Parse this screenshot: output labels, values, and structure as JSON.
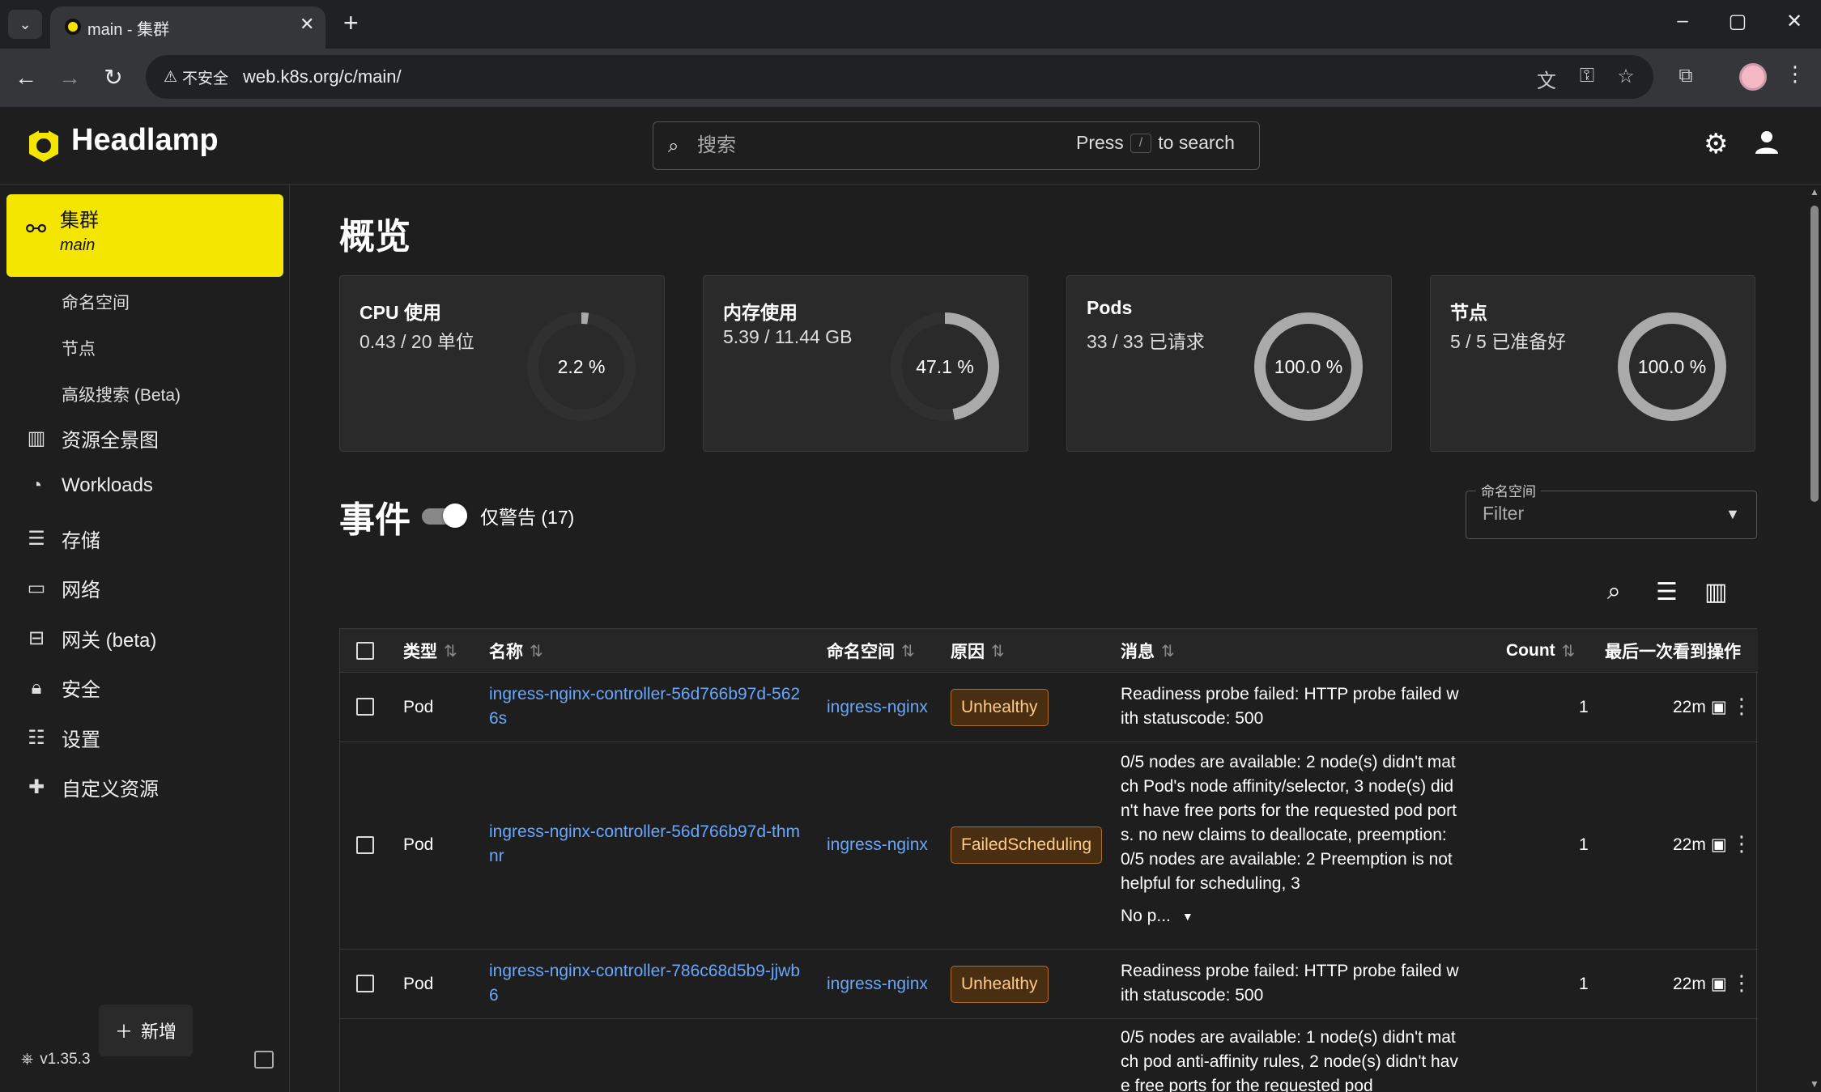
{
  "browser": {
    "tab_title": "main - 集群",
    "insecure_label": "不安全",
    "url": "web.k8s.org/c/main/"
  },
  "header": {
    "app_name": "Headlamp",
    "search_placeholder": "搜索",
    "search_hint_press": "Press",
    "search_hint_key": "/",
    "search_hint_suffix": "to search"
  },
  "sidebar": {
    "cluster_label": "集群",
    "cluster_name": "main",
    "subitems": [
      "命名空间",
      "节点",
      "高级搜索 (Beta)"
    ],
    "items": [
      "资源全景图",
      "Workloads",
      "存储",
      "网络",
      "网关 (beta)",
      "安全",
      "设置",
      "自定义资源"
    ],
    "add_label": "新增",
    "version": "v1.35.3"
  },
  "overview": {
    "title": "概览",
    "cards": [
      {
        "title": "CPU 使用",
        "value": "0.43 / 20 单位",
        "percent_label": "2.2 %",
        "percent": 2.2
      },
      {
        "title": "内存使用",
        "value": "5.39 / 11.44 GB",
        "percent_label": "47.1 %",
        "percent": 47.1
      },
      {
        "title": "Pods",
        "value": "33 / 33 已请求",
        "percent_label": "100.0 %",
        "percent": 100
      },
      {
        "title": "节点",
        "value": "5 / 5 已准备好",
        "percent_label": "100.0 %",
        "percent": 100
      }
    ]
  },
  "events": {
    "title": "事件",
    "warnings_only_label": "仅警告 (17)",
    "warnings_only_on": true,
    "namespace_filter_label": "命名空间",
    "namespace_filter_placeholder": "Filter",
    "columns": [
      "类型",
      "名称",
      "命名空间",
      "原因",
      "消息",
      "Count",
      "最后一次看到",
      "操作"
    ],
    "rows": [
      {
        "type": "Pod",
        "name": "ingress-nginx-controller-56d766b97d-5626s",
        "namespace": "ingress-nginx",
        "reason": "Unhealthy",
        "message": "Readiness probe failed: HTTP probe failed with statuscode: 500",
        "count": "1",
        "last_seen": "22m"
      },
      {
        "type": "Pod",
        "name": "ingress-nginx-controller-56d766b97d-thmnr",
        "namespace": "ingress-nginx",
        "reason": "FailedScheduling",
        "message": "0/5 nodes are available: 2 node(s) didn't match Pod's node affinity/selector, 3 node(s) didn't have free ports for the requested pod ports. no new claims to deallocate, preemption: 0/5 nodes are available: 2 Preemption is not helpful for scheduling, 3",
        "message_more": "No p...",
        "count": "1",
        "last_seen": "22m"
      },
      {
        "type": "Pod",
        "name": "ingress-nginx-controller-786c68d5b9-jjwb6",
        "namespace": "ingress-nginx",
        "reason": "Unhealthy",
        "message": "Readiness probe failed: HTTP probe failed with statuscode: 500",
        "count": "1",
        "last_seen": "22m"
      },
      {
        "type": "",
        "name": "",
        "namespace": "",
        "reason": "",
        "message": "0/5 nodes are available: 1 node(s) didn't match pod anti-affinity rules, 2 node(s) didn't have free ports for the requested pod",
        "count": "",
        "last_seen": ""
      }
    ]
  },
  "colors": {
    "accent": "#f5e600",
    "link": "#67a7ff",
    "badge_bg": "#4a2e12",
    "badge_border": "#b06d2a"
  }
}
